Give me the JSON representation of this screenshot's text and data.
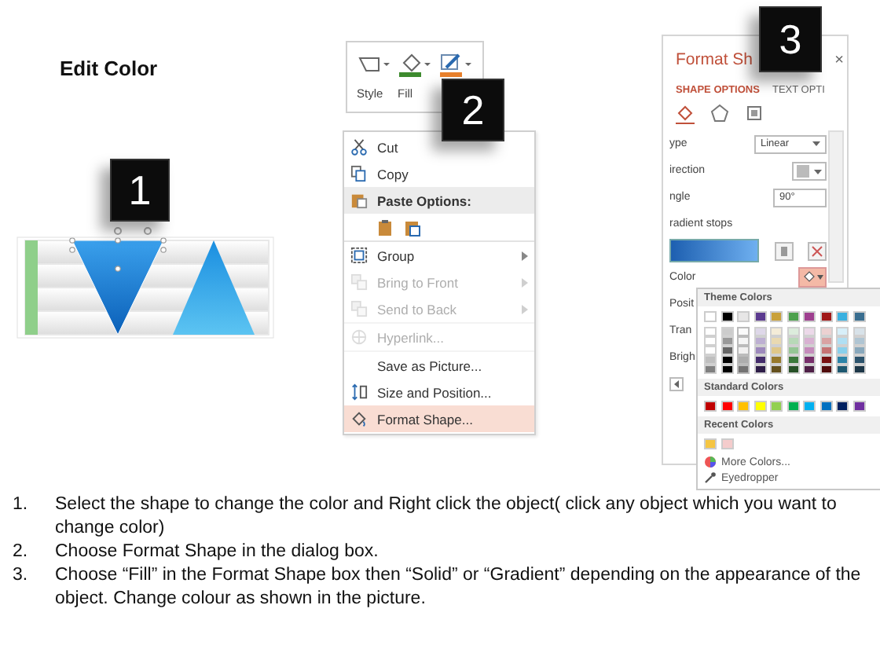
{
  "title": "Edit Color",
  "callouts": [
    "1",
    "2",
    "3"
  ],
  "ribbon": {
    "buttons": [
      {
        "kind": "style",
        "label": "Style"
      },
      {
        "kind": "fill",
        "label": "Fill"
      },
      {
        "kind": "outline"
      }
    ]
  },
  "context_menu": {
    "items": [
      {
        "kind": "cut",
        "label": "Cut",
        "disabled": false,
        "submenu": false,
        "selected": false,
        "divider_below": false
      },
      {
        "kind": "copy",
        "label": "Copy",
        "disabled": false,
        "submenu": false,
        "selected": false,
        "divider_below": false
      },
      {
        "kind": "paste_header",
        "label": "Paste Options:",
        "disabled": false,
        "submenu": false,
        "selected": false,
        "divider_below": false
      },
      {
        "kind": "paste_icons",
        "divider_below": true
      },
      {
        "kind": "group",
        "label": "Group",
        "disabled": false,
        "submenu": true,
        "selected": false,
        "divider_below": false
      },
      {
        "kind": "bring_front",
        "label": "Bring to Front",
        "disabled": true,
        "submenu": true,
        "selected": false,
        "divider_below": false
      },
      {
        "kind": "send_back",
        "label": "Send to Back",
        "disabled": true,
        "submenu": true,
        "selected": false,
        "divider_below": true
      },
      {
        "kind": "hyperlink",
        "label": "Hyperlink...",
        "disabled": true,
        "submenu": false,
        "selected": false,
        "divider_below": true
      },
      {
        "kind": "save_picture",
        "label": "Save as Picture...",
        "disabled": false,
        "submenu": false,
        "selected": false,
        "divider_below": false
      },
      {
        "kind": "size_position",
        "label": "Size and Position...",
        "disabled": false,
        "submenu": false,
        "selected": false,
        "divider_below": false
      },
      {
        "kind": "format_shape",
        "label": "Format Shape...",
        "disabled": false,
        "submenu": false,
        "selected": true,
        "divider_below": false
      }
    ]
  },
  "format_pane": {
    "title": "Format Sh",
    "close": "×",
    "tabs": [
      {
        "label": "SHAPE OPTIONS",
        "selected": true
      },
      {
        "label": "TEXT OPTI",
        "selected": false
      }
    ],
    "icon_tabs": [
      {
        "kind": "fill",
        "selected": true
      },
      {
        "kind": "effects",
        "selected": false
      },
      {
        "kind": "size",
        "selected": false
      }
    ],
    "rows": [
      {
        "kind": "dropdown",
        "label": "ype",
        "value": "Linear"
      },
      {
        "kind": "picker",
        "label": "irection"
      },
      {
        "kind": "spinner",
        "label": "ngle",
        "value": "90°"
      },
      {
        "kind": "heading",
        "label": "radient stops"
      },
      {
        "kind": "stops"
      },
      {
        "kind": "color",
        "label": "Color"
      },
      {
        "kind": "label",
        "label": "Posit"
      },
      {
        "kind": "label",
        "label": "Tran"
      },
      {
        "kind": "label",
        "label": "Brigh"
      },
      {
        "kind": "stepper"
      }
    ]
  },
  "color_palette": {
    "theme_heading": "Theme Colors",
    "theme_colors": [
      {
        "color": "#ffffff"
      },
      {
        "color": "#000000"
      },
      {
        "color": "#e7e6e6"
      },
      {
        "color": "#5b3a8f"
      },
      {
        "color": "#c9a13b"
      },
      {
        "color": "#4ea04e"
      },
      {
        "color": "#9e3f8f"
      },
      {
        "color": "#a01818"
      },
      {
        "color": "#3ab0e0"
      },
      {
        "color": "#3a6e90"
      }
    ],
    "standard_heading": "Standard Colors",
    "standard_colors": [
      {
        "color": "#c00000"
      },
      {
        "color": "#ff0000"
      },
      {
        "color": "#ffc000"
      },
      {
        "color": "#ffff00"
      },
      {
        "color": "#92d050"
      },
      {
        "color": "#00b050"
      },
      {
        "color": "#00b0f0"
      },
      {
        "color": "#0070c0"
      },
      {
        "color": "#002060"
      },
      {
        "color": "#7030a0"
      }
    ],
    "recent_heading": "Recent Colors",
    "recent_colors": [
      {
        "color": "#f5c542"
      },
      {
        "color": "#f4cccc"
      }
    ],
    "actions": [
      {
        "kind": "more",
        "label": "More Colors..."
      },
      {
        "kind": "eyedropper",
        "label": "Eyedropper"
      }
    ]
  },
  "instructions": [
    {
      "number": "1.",
      "text": "Select the shape to change the color and Right click the object( click any object which you want to change color)"
    },
    {
      "number": "2.",
      "text": "Choose Format Shape in the dialog box."
    },
    {
      "number": "3.",
      "text": "Choose “Fill” in the Format Shape box then “Solid” or “Gradient” depending on the appearance of the object. Change colour as shown in the picture."
    }
  ]
}
